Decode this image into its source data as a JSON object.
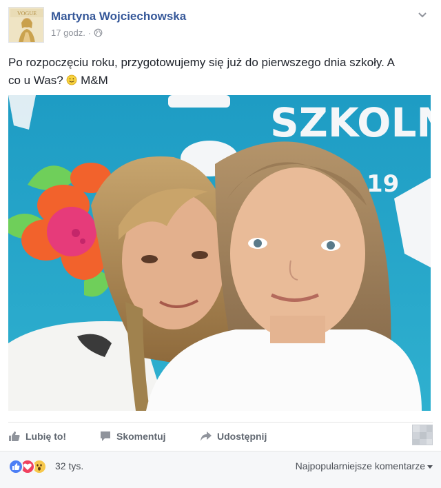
{
  "post": {
    "author": "Martyna Wojciechowska",
    "time": "17 godz.",
    "separator": "·",
    "visibility_icon": "globe-icon",
    "menu_icon": "chevron-down-icon",
    "text_line1": "Po rozpoczęciu roku, przygotowujemy się już do pierwszego dnia szkoły. A",
    "text_line2_pre": "co u Was?",
    "text_emoji": "smile-icon",
    "text_line2_post": "M&M",
    "photo": {
      "description_icon": "photo-selfie",
      "backdrop_text": "SZKOLNY",
      "backdrop_year": "19"
    }
  },
  "actions": {
    "like": "Lubię to!",
    "comment": "Skomentuj",
    "share": "Udostępnij"
  },
  "reactions": {
    "icons": [
      "like-reaction-icon",
      "love-reaction-icon",
      "wow-reaction-icon"
    ],
    "count": "32 tys.",
    "sort_label": "Najpopularniejsze komentarze"
  },
  "colors": {
    "link": "#365899",
    "meta": "#90949c",
    "action": "#606770",
    "like": "#4c7ef5",
    "love": "#f0415f",
    "wow": "#f7c84c",
    "photo_backdrop": "#2aa6c8"
  }
}
